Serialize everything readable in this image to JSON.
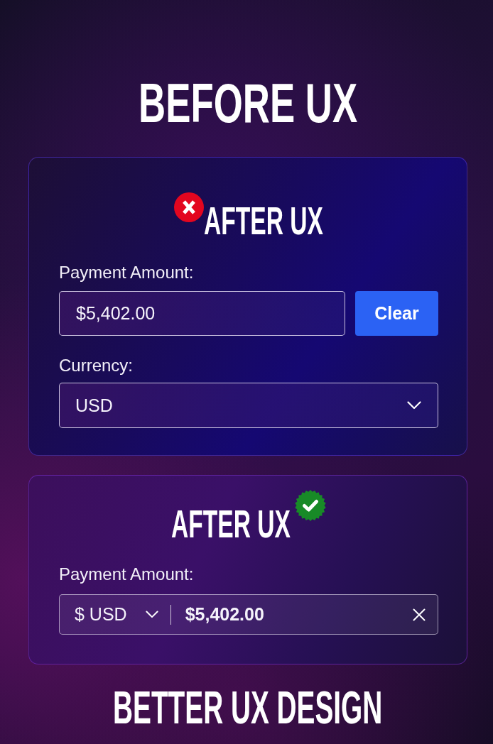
{
  "headline": {
    "text": "BEFORE UX"
  },
  "cards": [
    {
      "kind": "separate",
      "title": "AFTER UX",
      "approved": false,
      "amount_label": "Payment Amount:",
      "amount_value": "$5,402.00",
      "clear_button": "Clear",
      "currency_label": "Currency:",
      "currency_value": "USD"
    },
    {
      "kind": "combined",
      "title": "AFTER UX",
      "approved": true,
      "amount_label": "Payment Amount:",
      "currency_value": "$ USD",
      "amount_value": "$5,402.00"
    }
  ],
  "footer": {
    "text": "BETTER UX DESIGN"
  }
}
